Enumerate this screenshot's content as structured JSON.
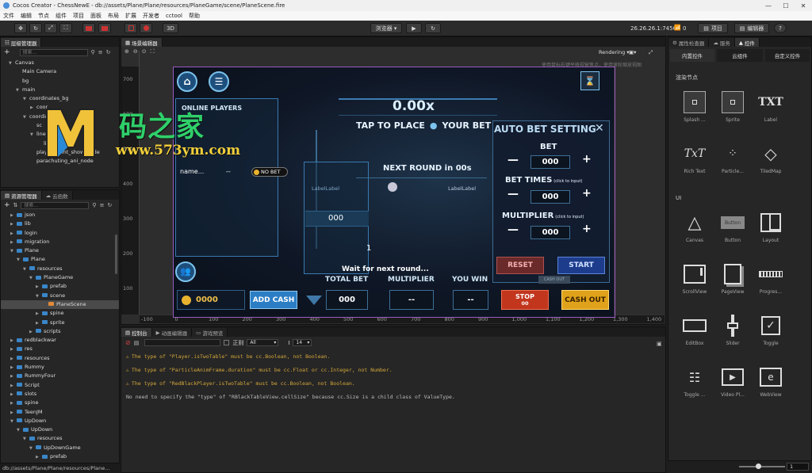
{
  "window": {
    "title": "Cocos Creator - ChessNewE - db://assets/Plane/Plane/resources/PlaneGame/scene/PlaneScene.fire"
  },
  "menu": [
    "文件",
    "编辑",
    "节点",
    "组件",
    "项目",
    "面板",
    "布局",
    "扩展",
    "开发者",
    "cctool",
    "帮助"
  ],
  "toolbar": {
    "mode_3d": "3D",
    "browser": "浏览器 ▾",
    "ip": "26.26.26.1:7456",
    "wifi_count": "0",
    "project_btn": "项目",
    "editor_btn": "编辑器",
    "help": "?"
  },
  "hierarchy": {
    "title": "层级管理器",
    "search_placeholder": "搜索...",
    "nodes": [
      {
        "label": "Canvas",
        "depth": 0,
        "open": true
      },
      {
        "label": "Main Camera",
        "depth": 1
      },
      {
        "label": "bg",
        "depth": 1
      },
      {
        "label": "main",
        "depth": 1,
        "open": true
      },
      {
        "label": "coordinates_bg",
        "depth": 2,
        "open": true
      },
      {
        "label": "coor",
        "depth": 3,
        "open": false
      },
      {
        "label": "coordinates",
        "depth": 2,
        "open": true
      },
      {
        "label": "sc",
        "depth": 3
      },
      {
        "label": "line_all_node",
        "depth": 3,
        "open": true
      },
      {
        "label": "line_node",
        "depth": 4
      },
      {
        "label": "player_point_show_node",
        "depth": 3
      },
      {
        "label": "parachuting_ani_node",
        "depth": 3
      }
    ]
  },
  "assets": {
    "title": "资源管理器",
    "tab2": "云函数",
    "search_placeholder": "搜索...",
    "items": [
      {
        "label": "json",
        "depth": 1,
        "open": false
      },
      {
        "label": "lib",
        "depth": 1,
        "open": false
      },
      {
        "label": "login",
        "depth": 1,
        "open": false
      },
      {
        "label": "migration",
        "depth": 1,
        "open": false
      },
      {
        "label": "Plane",
        "depth": 1,
        "open": true
      },
      {
        "label": "Plane",
        "depth": 2,
        "open": true
      },
      {
        "label": "resources",
        "depth": 3,
        "open": true
      },
      {
        "label": "PlaneGame",
        "depth": 4,
        "open": true
      },
      {
        "label": "prefab",
        "depth": 5,
        "open": false
      },
      {
        "label": "scene",
        "depth": 5,
        "open": true
      },
      {
        "label": "PlaneScene",
        "depth": 6,
        "scene": true,
        "selected": true
      },
      {
        "label": "spine",
        "depth": 5,
        "open": false
      },
      {
        "label": "sprite",
        "depth": 5,
        "open": false
      },
      {
        "label": "scripts",
        "depth": 4,
        "open": false
      },
      {
        "label": "redblackwar",
        "depth": 1,
        "open": false
      },
      {
        "label": "res",
        "depth": 1,
        "open": false
      },
      {
        "label": "resources",
        "depth": 1,
        "open": false
      },
      {
        "label": "Rummy",
        "depth": 1,
        "open": false
      },
      {
        "label": "RummyFour",
        "depth": 1,
        "open": false
      },
      {
        "label": "Script",
        "depth": 1,
        "open": false
      },
      {
        "label": "slots",
        "depth": 1,
        "open": false
      },
      {
        "label": "spine",
        "depth": 1,
        "open": false
      },
      {
        "label": "TeenJM",
        "depth": 1,
        "open": false
      },
      {
        "label": "UpDown",
        "depth": 1,
        "open": true
      },
      {
        "label": "UpDown",
        "depth": 2,
        "open": true
      },
      {
        "label": "resources",
        "depth": 3,
        "open": true
      },
      {
        "label": "UpDownGame",
        "depth": 4,
        "open": true
      },
      {
        "label": "prefab",
        "depth": 5,
        "open": false
      }
    ],
    "status": "db://assets/Plane/Plane/resources/Plane..."
  },
  "scene_editor": {
    "title": "场景编辑器",
    "hint": "使用鼠标右键平移视窗焦点，使用滚轮缩放视图",
    "rendering": "Rendering ▾",
    "ruler_y": [
      "700",
      "600",
      "500",
      "400",
      "300",
      "200",
      "100"
    ],
    "ruler_x": [
      "-100",
      "0",
      "100",
      "200",
      "300",
      "400",
      "500",
      "600",
      "700",
      "800",
      "900",
      "1,000",
      "1,100",
      "1,200",
      "1,300",
      "1,400"
    ]
  },
  "game": {
    "multiplier": "0.00x",
    "tap_to_place": "TAP TO PLACE",
    "your_bet": "YOUR BET",
    "online_players": "ONLINE PLAYERS",
    "player_name": "name...",
    "player_dash": "--",
    "no_bet": "NO BET",
    "next_round": "NEXT ROUND in 00s",
    "tag_left": "LabelLabel",
    "tag_right": "LabelLabel",
    "mid_value": "000",
    "mid_one": "1",
    "auto_bet_title": "AUTO BET SETTING",
    "bet_label": "BET",
    "bet_value": "000",
    "bet_times_label": "BET TIMES",
    "click_input": "(click to input)",
    "bet_times_value": "000",
    "multiplier_label": "MULTIPLIER",
    "multiplier_value": "000",
    "reset": "RESET",
    "start": "START",
    "wait": "Wait for next round...",
    "coins": "0000",
    "add_cash": "ADD CASH",
    "total_bet": "TOTAL BET",
    "total_bet_value": "000",
    "multiplier_col": "MULTIPLIER",
    "multiplier_col_value": "--",
    "you_win": "YOU WIN",
    "you_win_value": "--",
    "stop": "STOP",
    "stop_value": "00",
    "cash_out": "CASH OUT",
    "cashout_small": "CASH OUT"
  },
  "watermark": {
    "line1": "码之家",
    "line2": "www.573ym.com"
  },
  "console": {
    "tab": "控制台",
    "tab2": "动画编辑器",
    "tab3": "游戏预览",
    "regex": "正则",
    "level": "All",
    "font_size": "14",
    "logs": [
      {
        "text": "The type of \"Player.isTwoTable\" must be cc.Boolean, not Boolean.",
        "warn": true
      },
      {
        "text": "The type of \"ParticleAnimFrame.duration\" must be cc.Float or cc.Integer, not Number.",
        "warn": true
      },
      {
        "text": "The type of \"RedBlackPlayer.isTwoTable\" must be cc.Boolean, not Boolean.",
        "warn": true
      },
      {
        "text": "No need to specify the \"type\" of \"RBlackTableView.cellSize\" because cc.Size is a child class of ValueType.",
        "warn": false
      }
    ]
  },
  "right": {
    "tab1": "属性检查器",
    "tab2": "服务",
    "tab3": "控件",
    "subtabs": [
      "内置控件",
      "云组件",
      "自定义控件"
    ],
    "section1": "渲染节点",
    "section2": "UI",
    "render_nodes": [
      {
        "label": "Splash ...",
        "icon": "splash-icon"
      },
      {
        "label": "Sprite",
        "icon": "sprite-icon"
      },
      {
        "label": "Label",
        "icon": "label-icon"
      },
      {
        "label": "Rich Text",
        "icon": "richtext-icon"
      },
      {
        "label": "Particle...",
        "icon": "particle-icon"
      },
      {
        "label": "TiledMap",
        "icon": "tiledmap-icon"
      }
    ],
    "ui_nodes": [
      {
        "label": "Canvas",
        "icon": "canvas-icon"
      },
      {
        "label": "Button",
        "icon": "button-icon"
      },
      {
        "label": "Layout",
        "icon": "layout-icon"
      },
      {
        "label": "ScrollView",
        "icon": "scrollview-icon"
      },
      {
        "label": "PageView",
        "icon": "pageview-icon"
      },
      {
        "label": "Progres...",
        "icon": "progress-icon"
      },
      {
        "label": "EditBox",
        "icon": "editbox-icon"
      },
      {
        "label": "Slider",
        "icon": "slider-icon"
      },
      {
        "label": "Toggle",
        "icon": "toggle-icon"
      },
      {
        "label": "Toggle ...",
        "icon": "togglegroup-icon"
      },
      {
        "label": "Video Pl...",
        "icon": "videoplayer-icon"
      },
      {
        "label": "WebView",
        "icon": "webview-icon"
      }
    ],
    "zoom": "1",
    "button_glyph": "Button",
    "txt_glyph": "TXT",
    "rich_glyph": "TxT"
  },
  "colors": {
    "accent": "#3a86c8",
    "warn": "#d4a73a",
    "cyan": "#bfe7ff",
    "reset": "#7a2a2a",
    "start": "#1a3a8a",
    "stop": "#c2361e",
    "cashout": "#e0a21a"
  }
}
